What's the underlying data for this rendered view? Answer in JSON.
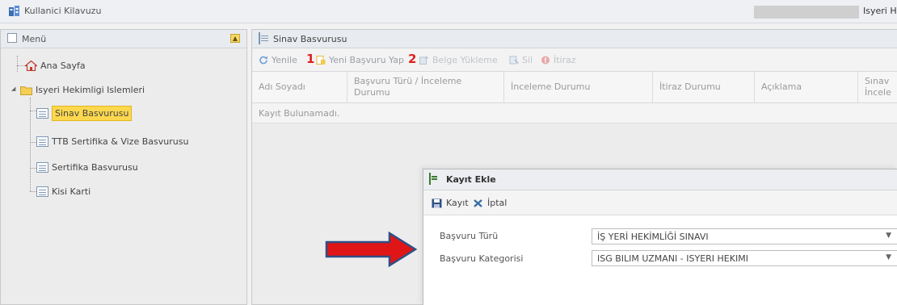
{
  "app": {
    "title": "Kullanici Kilavuzu",
    "user": "Isyeri Hek"
  },
  "menu": {
    "title": "Menü",
    "items": [
      {
        "label": "Ana Sayfa"
      },
      {
        "label": "Isyeri Hekimligi Islemleri"
      },
      {
        "label": "Sinav Basvurusu"
      },
      {
        "label": "TTB Sertifika & Vize Basvurusu"
      },
      {
        "label": "Sertifika Basvurusu"
      },
      {
        "label": "Kisi Karti"
      }
    ]
  },
  "tab": {
    "title": "Sinav Basvurusu"
  },
  "toolbar": {
    "refresh": "Yenile",
    "step1": "1",
    "new_application": "Yeni Başvuru Yap",
    "step2": "2",
    "upload_document": "Belge Yükleme",
    "delete": "Sil",
    "objection": "İtiraz"
  },
  "grid": {
    "columns": [
      "Adı Soyadı",
      "Başvuru Türü / İnceleme Durumu",
      "İnceleme Durumu",
      "İtiraz Durumu",
      "Açıklama",
      "Sınav İncele"
    ],
    "empty_text": "Kayıt Bulunamadı."
  },
  "dialog": {
    "title": "Kayıt Ekle",
    "save_label": "Kayıt",
    "cancel_label": "İptal",
    "fields": [
      {
        "label": "Başvuru Türü",
        "value": "İŞ YERİ HEKİMLİĞİ SINAVI"
      },
      {
        "label": "Başvuru Kategorisi",
        "value": "ISG BILIM UZMANI - ISYERI HEKIMI"
      }
    ]
  },
  "colors": {
    "selection": "#fdd84e",
    "arrow_fill": "#e01515",
    "arrow_outline": "#2f4f86",
    "step_numbers": "#e02020"
  }
}
